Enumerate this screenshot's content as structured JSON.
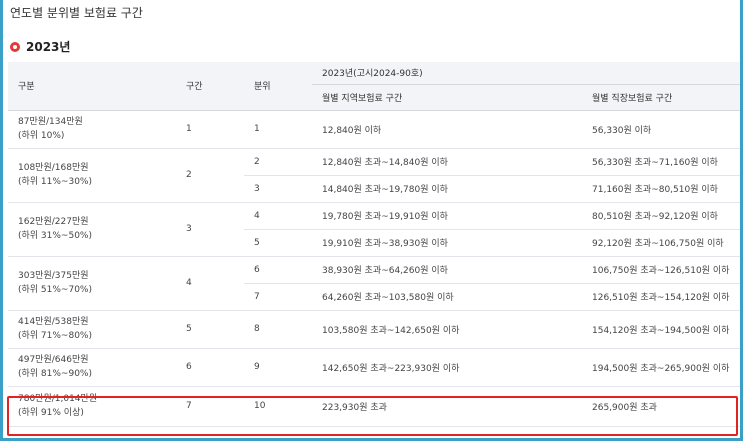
{
  "page": {
    "title": "연도별 분위별 보험료 구간",
    "year": "2023년"
  },
  "table": {
    "headers": {
      "category": "구분",
      "section": "구간",
      "quintile": "분위",
      "group": "2023년(고시2024-90호)",
      "regional": "월별 지역보험료 구간",
      "workplace": "월별 직장보험료 구간"
    },
    "groups": [
      {
        "line1": "87만원/134만원",
        "line2": "(하위 10%)",
        "section": "1",
        "rows": [
          {
            "quintile": "1",
            "regional": "12,840원 이하",
            "workplace": "56,330원 이하"
          }
        ]
      },
      {
        "line1": "108만원/168만원",
        "line2": "(하위 11%~30%)",
        "section": "2",
        "rows": [
          {
            "quintile": "2",
            "regional": "12,840원 초과~14,840원 이하",
            "workplace": "56,330원 초과~71,160원 이하"
          },
          {
            "quintile": "3",
            "regional": "14,840원 초과~19,780원 이하",
            "workplace": "71,160원 초과~80,510원 이하"
          }
        ]
      },
      {
        "line1": "162만원/227만원",
        "line2": "(하위 31%~50%)",
        "section": "3",
        "rows": [
          {
            "quintile": "4",
            "regional": "19,780원 초과~19,910원 이하",
            "workplace": "80,510원 초과~92,120원 이하"
          },
          {
            "quintile": "5",
            "regional": "19,910원 초과~38,930원 이하",
            "workplace": "92,120원 초과~106,750원 이하"
          }
        ]
      },
      {
        "line1": "303만원/375만원",
        "line2": "(하위 51%~70%)",
        "section": "4",
        "rows": [
          {
            "quintile": "6",
            "regional": "38,930원 초과~64,260원 이하",
            "workplace": "106,750원 초과~126,510원 이하"
          },
          {
            "quintile": "7",
            "regional": "64,260원 초과~103,580원 이하",
            "workplace": "126,510원 초과~154,120원 이하"
          }
        ]
      },
      {
        "line1": "414만원/538만원",
        "line2": "(하위 71%~80%)",
        "section": "5",
        "rows": [
          {
            "quintile": "8",
            "regional": "103,580원 초과~142,650원 이하",
            "workplace": "154,120원 초과~194,500원 이하"
          }
        ]
      },
      {
        "line1": "497만원/646만원",
        "line2": "(하위 81%~90%)",
        "section": "6",
        "rows": [
          {
            "quintile": "9",
            "regional": "142,650원 초과~223,930원 이하",
            "workplace": "194,500원 초과~265,900원 이하"
          }
        ]
      },
      {
        "line1": "780만원/1,014만원",
        "line2": "(하위 91% 이상)",
        "section": "7",
        "rows": [
          {
            "quintile": "10",
            "regional": "223,930원 초과",
            "workplace": "265,900원 초과"
          }
        ]
      }
    ]
  },
  "colors": {
    "highlight": "#e02424",
    "year_dot": "#e03a3a",
    "header_bg": "#f3f4f8",
    "frame": "#3aa0c8"
  }
}
